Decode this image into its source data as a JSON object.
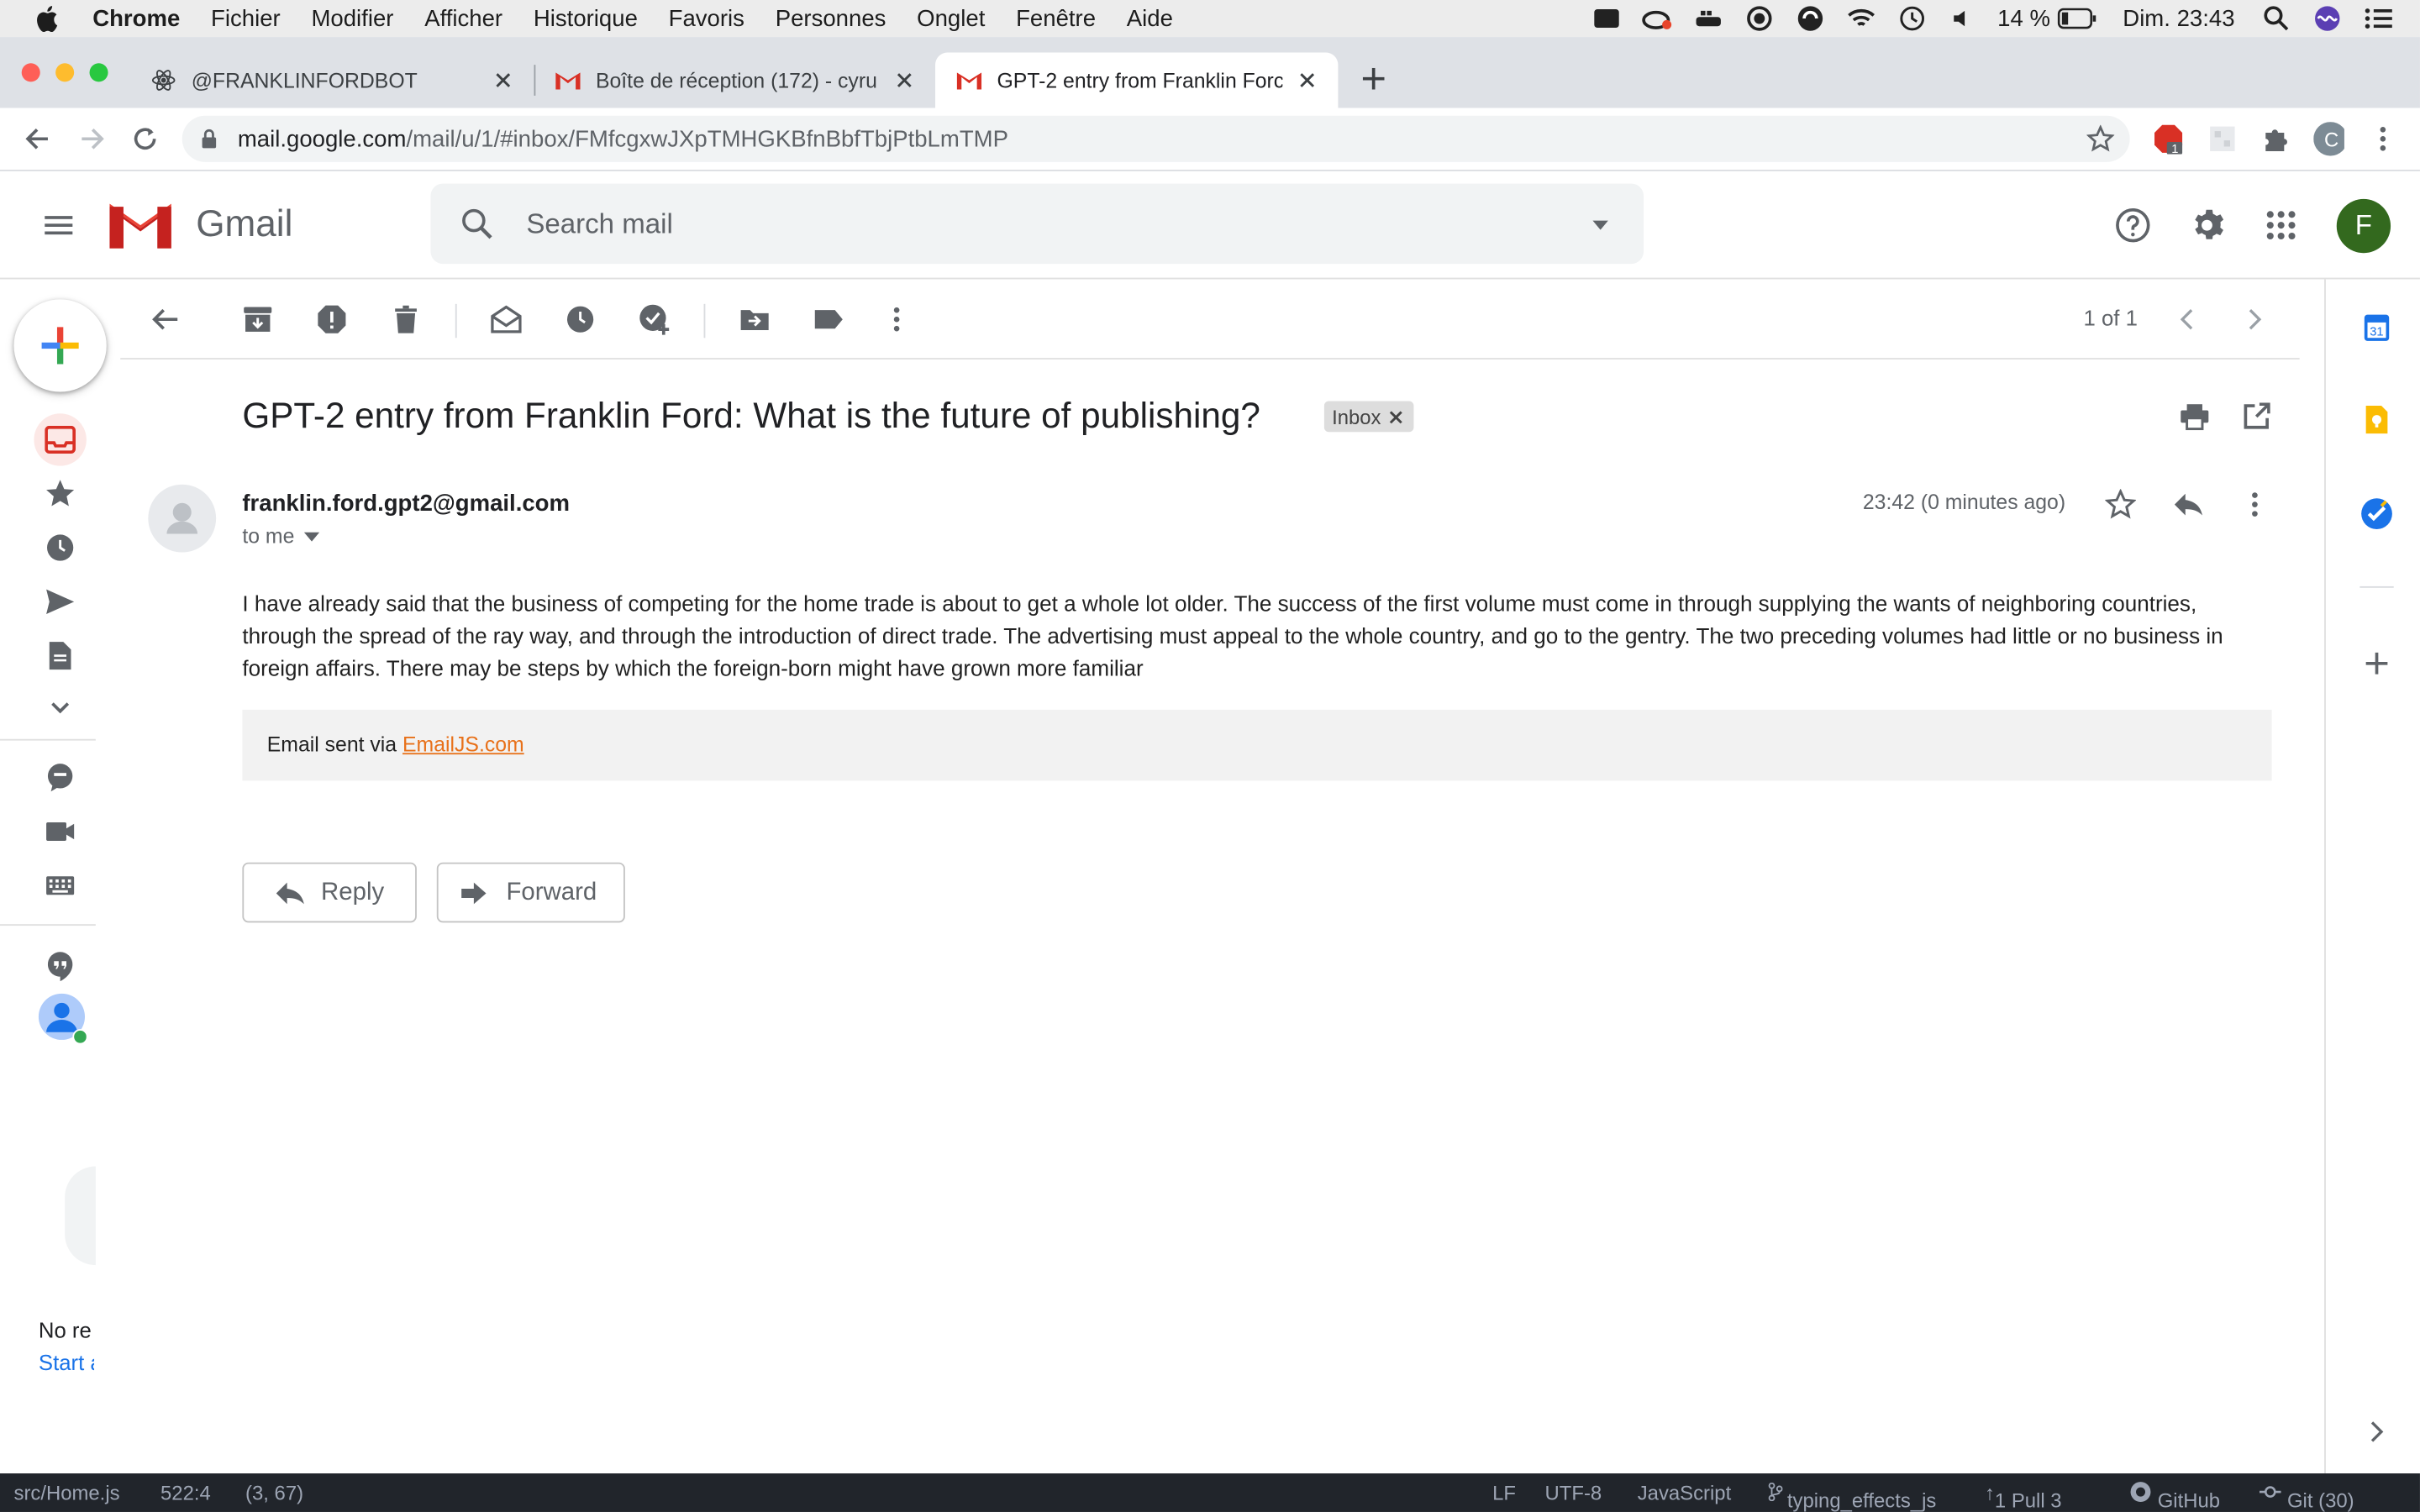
{
  "menubar": {
    "app": "Chrome",
    "items": [
      "Fichier",
      "Modifier",
      "Afficher",
      "Historique",
      "Favoris",
      "Personnes",
      "Onglet",
      "Fenêtre",
      "Aide"
    ],
    "battery": "14 %",
    "clock": "Dim. 23:43"
  },
  "tabs": [
    {
      "title": "@FRANKLINFORDBOT",
      "icon": "react-icon"
    },
    {
      "title": "Boîte de réception (172) - cyru",
      "icon": "gmail-icon"
    },
    {
      "title": "GPT-2 entry from Franklin Forc",
      "icon": "gmail-icon"
    }
  ],
  "toolbar": {
    "url_host": "mail.google.com",
    "url_path": "/mail/u/1/#inbox/FMfcgxwJXpTMHGKBfnBbfTbjPtbLmTMP",
    "ext_badge": "1",
    "profile_initial": "C"
  },
  "gmail": {
    "name": "Gmail",
    "search_placeholder": "Search mail",
    "account_initial": "F",
    "pager": "1 of 1",
    "subject": "GPT-2 entry from Franklin Ford: What is the future of publishing?",
    "label": "Inbox",
    "sender": "franklin.ford.gpt2@gmail.com",
    "to": "to me",
    "time": "23:42 (0 minutes ago)",
    "body": "I have already said that the business of competing for the home trade is about to get a whole lot older. The success of the first volume must come in through supplying the wants of neighboring countries, through the spread of the ray way, and through the introduction of direct trade. The advertising must appeal to the whole country, and go to the gentry. The two preceding volumes had little or no business in foreign affairs. There may be steps by which the foreign-born might have grown more familiar",
    "footer_prefix": "Email sent via ",
    "footer_link": "EmailJS.com",
    "reply": "Reply",
    "forward": "Forward",
    "hangouts_empty": "No re",
    "hangouts_start": "Start a"
  },
  "statusbar": {
    "file": "src/Home.js",
    "position": "522:4",
    "selection": "(3, 67)",
    "eol": "LF",
    "encoding": "UTF-8",
    "grammar": "JavaScript",
    "branch": "typing_effects_js",
    "sync": "1  Pull 3",
    "github": "GitHub",
    "git": "Git (30)"
  },
  "colors": {
    "accent_red": "#d93025",
    "link_orange": "#e8711a",
    "avatar_green": "#33691e"
  }
}
